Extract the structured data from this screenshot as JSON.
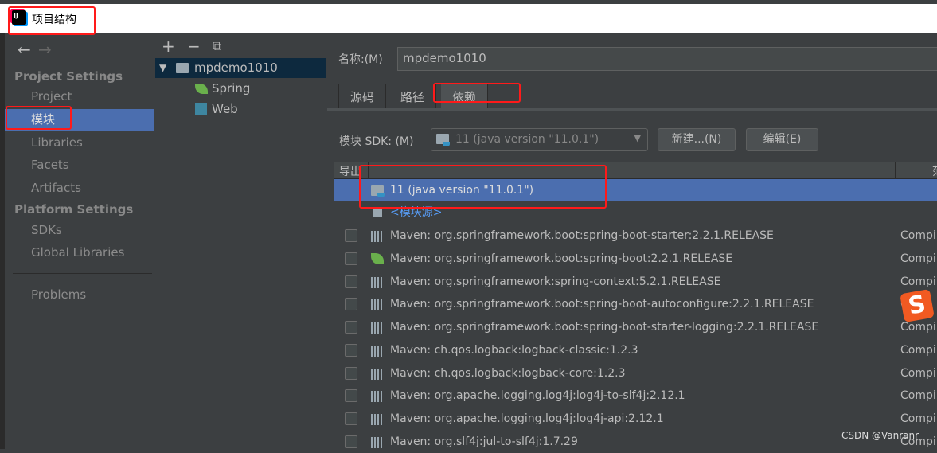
{
  "window": {
    "title": "项目结构"
  },
  "sidebar": {
    "project_settings": "Project Settings",
    "platform_settings": "Platform Settings",
    "items": [
      {
        "label": "Project"
      },
      {
        "label": "模块"
      },
      {
        "label": "Libraries"
      },
      {
        "label": "Facets"
      },
      {
        "label": "Artifacts"
      },
      {
        "label": "SDKs"
      },
      {
        "label": "Global Libraries"
      },
      {
        "label": "Problems"
      }
    ],
    "selected": "模块"
  },
  "tree": {
    "root": "mpdemo1010",
    "children": [
      {
        "label": "Spring"
      },
      {
        "label": "Web"
      }
    ]
  },
  "main": {
    "name_label": "名称:(M)",
    "name_value": "mpdemo1010",
    "tabs": [
      {
        "label": "源码"
      },
      {
        "label": "路径"
      },
      {
        "label": "依赖"
      }
    ],
    "active_tab": "依赖",
    "sdk_label": "模块 SDK:  (M)",
    "sdk_value": "11 (java version \"11.0.1\")",
    "new_button": "新建...(N)",
    "edit_button": "编辑(E)",
    "col_export": "导出",
    "col_scope": "范围",
    "sdk_row": "11 (java version \"11.0.1\")",
    "module_source": "<模块源>",
    "dependencies": [
      {
        "name": "Maven: org.springframework.boot:spring-boot-starter:2.2.1.RELEASE",
        "scope": "Compi"
      },
      {
        "name": "Maven: org.springframework.boot:spring-boot:2.2.1.RELEASE",
        "scope": "Compi"
      },
      {
        "name": "Maven: org.springframework:spring-context:5.2.1.RELEASE",
        "scope": "Compi"
      },
      {
        "name": "Maven: org.springframework.boot:spring-boot-autoconfigure:2.2.1.RELEASE",
        "scope": "C"
      },
      {
        "name": "Maven: org.springframework.boot:spring-boot-starter-logging:2.2.1.RELEASE",
        "scope": "Compi"
      },
      {
        "name": "Maven: ch.qos.logback:logback-classic:1.2.3",
        "scope": "Compi"
      },
      {
        "name": "Maven: ch.qos.logback:logback-core:1.2.3",
        "scope": "Compi"
      },
      {
        "name": "Maven: org.apache.logging.log4j:log4j-to-slf4j:2.12.1",
        "scope": "Compi"
      },
      {
        "name": "Maven: org.apache.logging.log4j:log4j-api:2.12.1",
        "scope": "Compi"
      },
      {
        "name": "Maven: org.slf4j:jul-to-slf4j:1.7.29",
        "scope": "Compi"
      }
    ]
  },
  "watermark": "CSDN @Vanranr",
  "colors": {
    "selection": "#4b6eaf",
    "annotation": "#ff1a1a",
    "link": "#589df6"
  }
}
